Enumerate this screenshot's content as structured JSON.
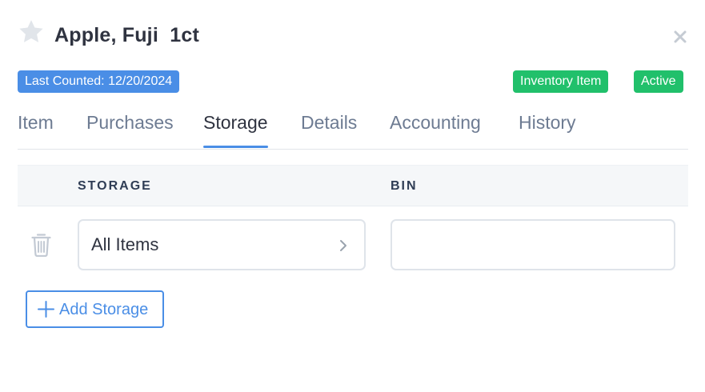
{
  "header": {
    "title": "Apple, Fuji  1ct",
    "favorite_icon": "star-icon",
    "close_icon": "close-icon"
  },
  "badges": {
    "last_counted": "Last Counted: 12/20/2024",
    "inventory_item": "Inventory Item",
    "active": "Active"
  },
  "tabs": [
    {
      "label": "Item"
    },
    {
      "label": "Purchases"
    },
    {
      "label": "Storage",
      "active": true
    },
    {
      "label": "Details"
    },
    {
      "label": "Accounting"
    },
    {
      "label": "History"
    }
  ],
  "table": {
    "columns": [
      "STORAGE",
      "BIN"
    ],
    "rows": [
      {
        "storage": "All Items",
        "bin": ""
      }
    ]
  },
  "actions": {
    "add_storage": "Add Storage"
  },
  "colors": {
    "accent": "#4a8ee6",
    "success": "#21c06b"
  }
}
